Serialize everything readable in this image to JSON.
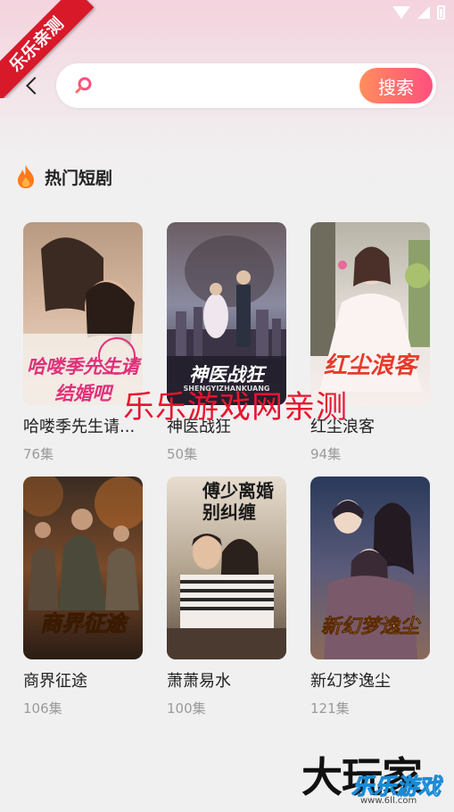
{
  "ribbon": {
    "text": "乐乐亲测"
  },
  "search": {
    "placeholder": "",
    "button_label": "搜索"
  },
  "section": {
    "title": "热门短剧"
  },
  "dramas": [
    {
      "title": "哈喽季先生请...",
      "episodes": "76集",
      "poster_text": "哈喽季先生请结婚吧"
    },
    {
      "title": "神医战狂",
      "episodes": "50集",
      "poster_text": "神医战狂",
      "poster_sub": "SHENGYIZHANKUANG"
    },
    {
      "title": "红尘浪客",
      "episodes": "94集",
      "poster_text": "红尘浪客"
    },
    {
      "title": "商界征途",
      "episodes": "106集",
      "poster_text": "商界征途"
    },
    {
      "title": "萧萧易水",
      "episodes": "100集",
      "poster_text": "傅少离婚别纠缠"
    },
    {
      "title": "新幻梦逸尘",
      "episodes": "121集",
      "poster_text": "新幻梦逸尘"
    }
  ],
  "watermarks": {
    "center": "乐乐游戏网亲测",
    "brand": "大玩家",
    "brand_sub": "乐乐游戏",
    "url": "www.6ll.com"
  },
  "colors": {
    "accent_start": "#ff8e5c",
    "accent_end": "#ff4f7e",
    "watermark_red": "#e8152f"
  }
}
